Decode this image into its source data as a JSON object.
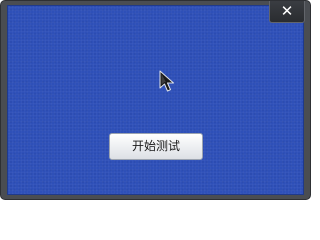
{
  "window": {
    "close_label": "✕",
    "close_icon": "close-icon",
    "background_color": "#2e50b8",
    "frame_color": "#4a4d52"
  },
  "cursor": {
    "icon": "mouse-pointer-icon"
  },
  "start_button": {
    "label": "开始测试"
  }
}
